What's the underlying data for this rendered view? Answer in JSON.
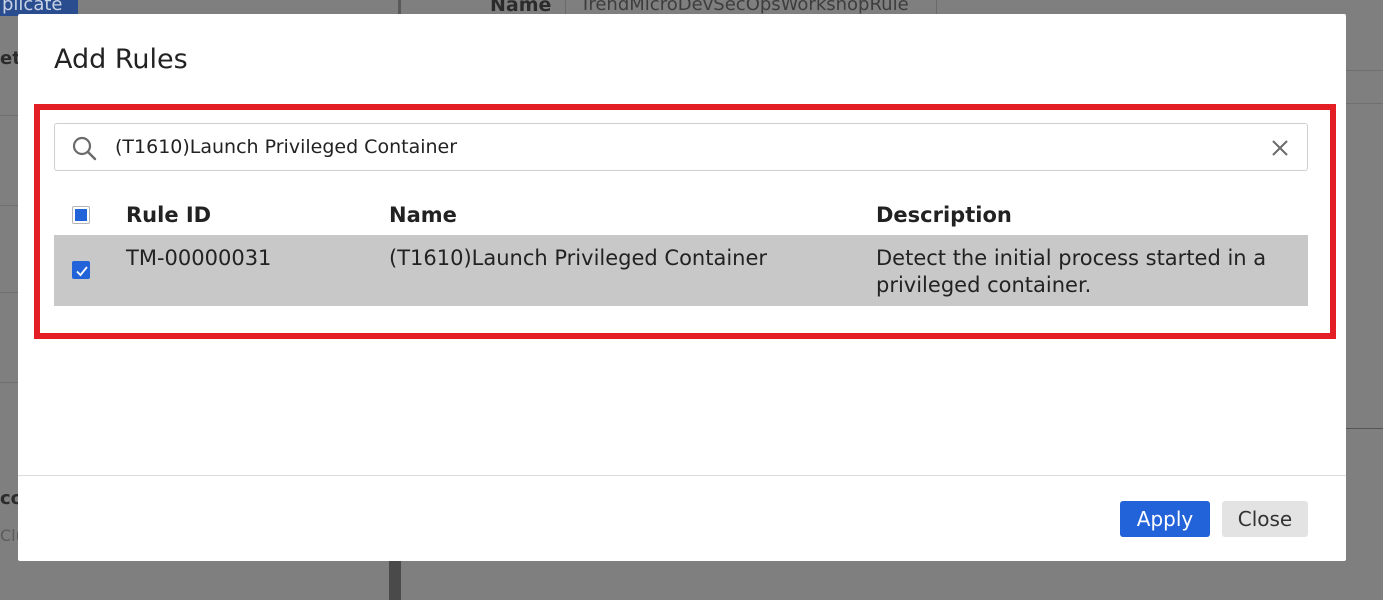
{
  "background": {
    "duplicate_label": "plicate",
    "left_labels": [
      "et",
      "co"
    ],
    "left_sub": "Clu",
    "name_label": "Name",
    "name_value": "TrendMicroDevSecOpsWorkshopRule"
  },
  "modal": {
    "title": "Add Rules",
    "search": {
      "value": "(T1610)Launch Privileged Container"
    },
    "table": {
      "headers": {
        "rule_id": "Rule ID",
        "name": "Name",
        "description": "Description"
      },
      "rows": [
        {
          "rule_id": "TM-00000031",
          "name": "(T1610)Launch Privileged Container",
          "description_line1": "Detect the initial process started in a",
          "description_line2": "privileged container.",
          "checked": true
        }
      ]
    },
    "buttons": {
      "apply": "Apply",
      "close": "Close"
    }
  },
  "colors": {
    "accent": "#2363d9",
    "highlight": "#e31e24",
    "selected_row": "#c8c8c8"
  },
  "icons": [
    "search-icon",
    "close-icon",
    "checkbox-checked-icon"
  ]
}
